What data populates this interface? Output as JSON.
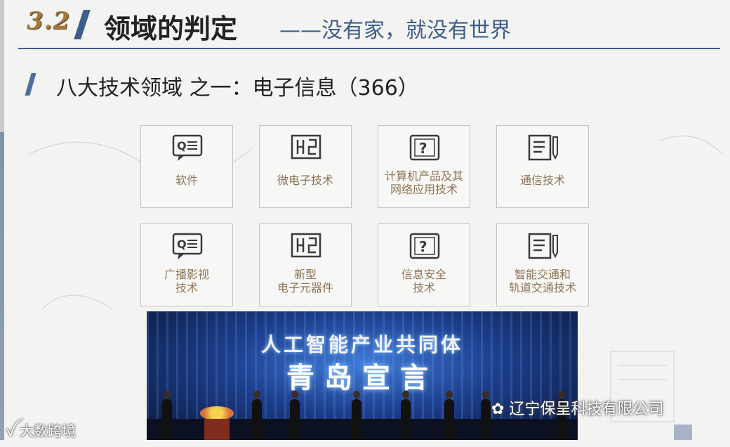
{
  "header": {
    "slide_number": "3.2",
    "title": "领域的判定",
    "subtitle": "——没有家，就没有世界"
  },
  "section": {
    "title": "八大技术领域 之一：电子信息（366）"
  },
  "tiles": [
    {
      "label": "软件",
      "icon": "speech-document-icon"
    },
    {
      "label": "微电子技术",
      "icon": "circuit-chip-icon"
    },
    {
      "label": "计算机产品及其\n网络应用技术",
      "icon": "question-monitor-icon"
    },
    {
      "label": "通信技术",
      "icon": "document-pen-icon"
    },
    {
      "label": "广播影视\n技术",
      "icon": "speech-document-icon"
    },
    {
      "label": "新型\n电子元器件",
      "icon": "circuit-chip-icon"
    },
    {
      "label": "信息安全\n技术",
      "icon": "question-monitor-icon"
    },
    {
      "label": "智能交通和\n轨道交通技术",
      "icon": "document-pen-icon"
    }
  ],
  "photo": {
    "caption_line1": "人工智能产业共同体",
    "caption_line2": "青岛宣言"
  },
  "watermarks": {
    "left": "大数跨境",
    "right": "辽宁保呈科技有限公司"
  },
  "colors": {
    "accent_blue": "#3e5e8a",
    "slide_number_gold": "#a4773a",
    "tile_label_brown": "#8d7352"
  }
}
